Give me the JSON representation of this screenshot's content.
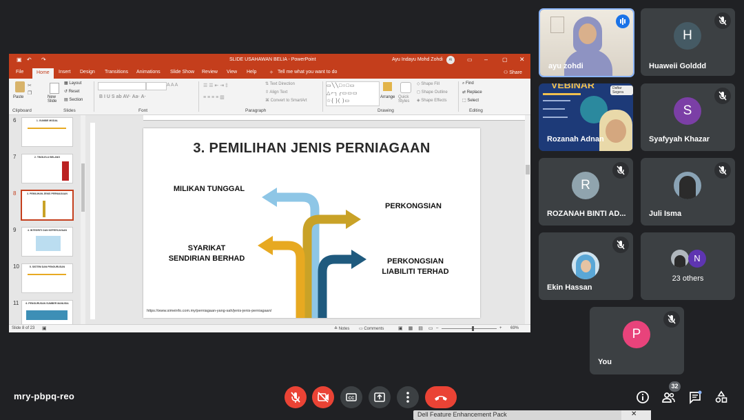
{
  "ppt": {
    "window_title": "SLIDE USAHAWAN BELIA  -  PowerPoint",
    "user_name": "Ayu Indayu Mohd Zohdi",
    "user_initials": "AI",
    "tabs": [
      "File",
      "Home",
      "Insert",
      "Design",
      "Transitions",
      "Animations",
      "Slide Show",
      "Review",
      "View",
      "Help"
    ],
    "tell_me": "Tell me what you want to do",
    "share": "Share",
    "ribbon": {
      "paste": "Paste",
      "new_slide": "New Slide",
      "layout": "Layout",
      "reset": "Reset",
      "section": "Section",
      "text_direction": "Text Direction",
      "align_text": "Align Text",
      "convert_smartart": "Convert to SmartArt",
      "arrange": "Arrange",
      "quick_styles": "Quick Styles",
      "shape_fill": "Shape Fill",
      "shape_outline": "Shape Outline",
      "shape_effects": "Shape Effects",
      "find": "Find",
      "replace": "Replace",
      "select": "Select",
      "groups": [
        "Clipboard",
        "Slides",
        "Font",
        "Paragraph",
        "Drawing",
        "Editing"
      ]
    },
    "thumbnails": [
      {
        "num": "6",
        "title": "1. GUNBIE MODAL"
      },
      {
        "num": "7",
        "title": "2. TINGLELU BELANG"
      },
      {
        "num": "8",
        "title": "3. PEMILIHAN JENIS PERNIAGAAN"
      },
      {
        "num": "9",
        "title": "4. INTEGRITI DAN KEPERCAYAAN"
      },
      {
        "num": "10",
        "title": "5. SISTEM DAN PENGURUSAN"
      },
      {
        "num": "11",
        "title": "6. PENGURUSAN SUMBER MANUSIA"
      }
    ],
    "slide": {
      "title": "3. PEMILIHAN JENIS PERNIAGAAN",
      "milikan": "MILIKAN TUNGGAL",
      "perkongsian": "PERKONGSIAN",
      "syarikat": "SYARIKAT\nSENDIRIAN BERHAD",
      "plt": "PERKONGSIAN\nLIABILITI TERHAD",
      "url": "https://www.simeinfo.com.my/perniagaan-yang-sah/jenis-jenis-perniagaan/"
    },
    "status": {
      "slide_count": "Slide 8 of 23",
      "notes": "Notes",
      "comments": "Comments",
      "zoom": "69%"
    },
    "colors": {
      "accent": "#c43e1c",
      "arrow_blue": "#8ec6e6",
      "arrow_gold": "#c9a227",
      "arrow_orange": "#e7a921",
      "arrow_navy": "#1f5a7e"
    }
  },
  "participants": [
    {
      "name": "ayu zohdi",
      "type": "video",
      "speaking": true
    },
    {
      "name": "Huaweii Golddd",
      "initial": "H",
      "color": "#455a64",
      "muted": true
    },
    {
      "name": "Rozanah Adnan",
      "type": "video"
    },
    {
      "name": "Syafyyah Khazar",
      "initial": "S",
      "color": "#7b3fa6",
      "muted": true
    },
    {
      "name": "ROZANAH BINTI AD...",
      "initial": "R",
      "color": "#90a4ae",
      "muted": true
    },
    {
      "name": "Juli Isma",
      "type": "photo",
      "muted": true
    },
    {
      "name": "Ekin Hassan",
      "type": "photo",
      "muted": true
    },
    {
      "name": "23 others",
      "others_initial": "N"
    },
    {
      "name": "You",
      "initial": "P",
      "color": "#e8437b",
      "muted": true
    }
  ],
  "rozanah_tile": {
    "banner": "VEBINAR",
    "tag": "Daftar Segera"
  },
  "meeting": {
    "code": "mry-pbpq-reo",
    "people_count": "32"
  },
  "notification": "Dell Feature Enhancement Pack"
}
